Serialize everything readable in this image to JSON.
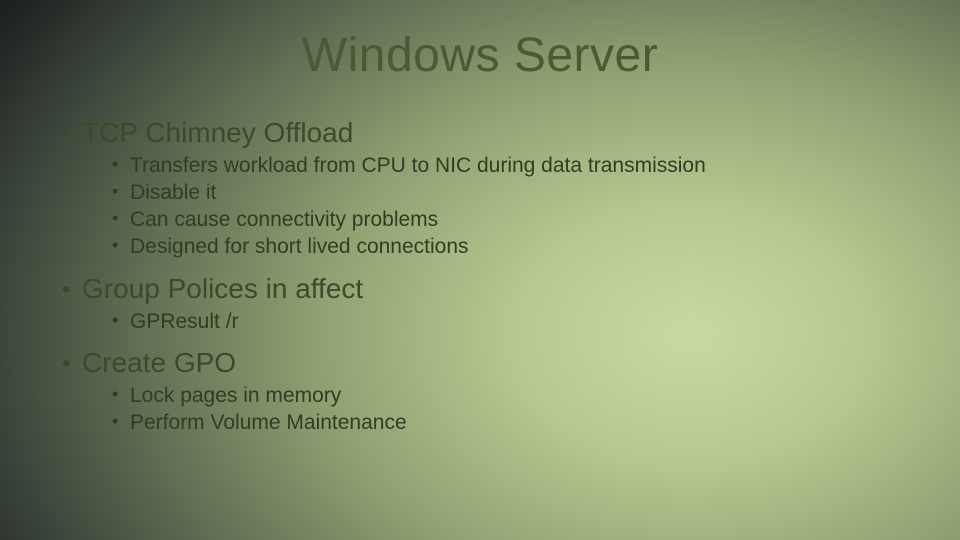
{
  "title": "Windows Server",
  "bullets": [
    {
      "text": "TCP Chimney Offload",
      "sub": [
        "Transfers workload from CPU to NIC during data transmission",
        "Disable it",
        "Can cause connectivity problems",
        "Designed for short lived connections"
      ]
    },
    {
      "text": "Group Polices in affect",
      "sub": [
        "GPResult /r"
      ]
    },
    {
      "text": "Create GPO",
      "sub": [
        "Lock pages in memory",
        "Perform Volume Maintenance"
      ]
    }
  ]
}
